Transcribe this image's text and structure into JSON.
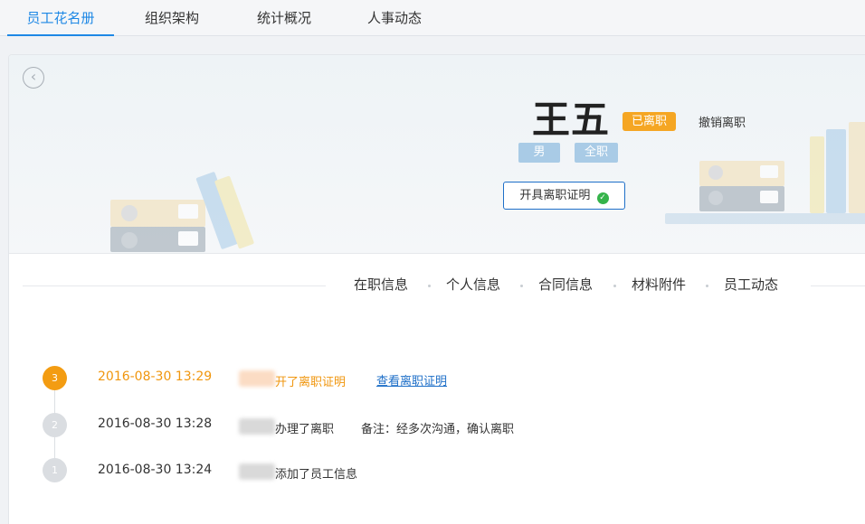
{
  "nav": {
    "tabs": [
      {
        "label": "员工花名册",
        "active": true
      },
      {
        "label": "组织架构",
        "active": false
      },
      {
        "label": "统计概况",
        "active": false
      },
      {
        "label": "人事动态",
        "active": false
      }
    ]
  },
  "profile": {
    "name": "王五",
    "status": "已离职",
    "revoke_label": "撤销离职",
    "tags": [
      "男",
      "全职"
    ],
    "certificate_button": "开具离职证明"
  },
  "sections": [
    "在职信息",
    "个人信息",
    "合同信息",
    "材料附件",
    "员工动态"
  ],
  "timeline": [
    {
      "step": "3",
      "time": "2016-08-30 13:29",
      "action": "开了离职证明",
      "link": "查看离职证明",
      "active": true
    },
    {
      "step": "2",
      "time": "2016-08-30 13:28",
      "action": "办理了离职",
      "note": "备注：经多次沟通，确认离职",
      "active": false
    },
    {
      "step": "1",
      "time": "2016-08-30 13:24",
      "action": "添加了员工信息",
      "active": false
    }
  ],
  "colors": {
    "accent": "#1e88e5",
    "status_orange": "#f5a623",
    "tag_blue": "#a9cbe6",
    "check_green": "#35b34a"
  },
  "icons": {
    "back": "chevron-left-circle-icon",
    "check": "check-circle-icon"
  }
}
